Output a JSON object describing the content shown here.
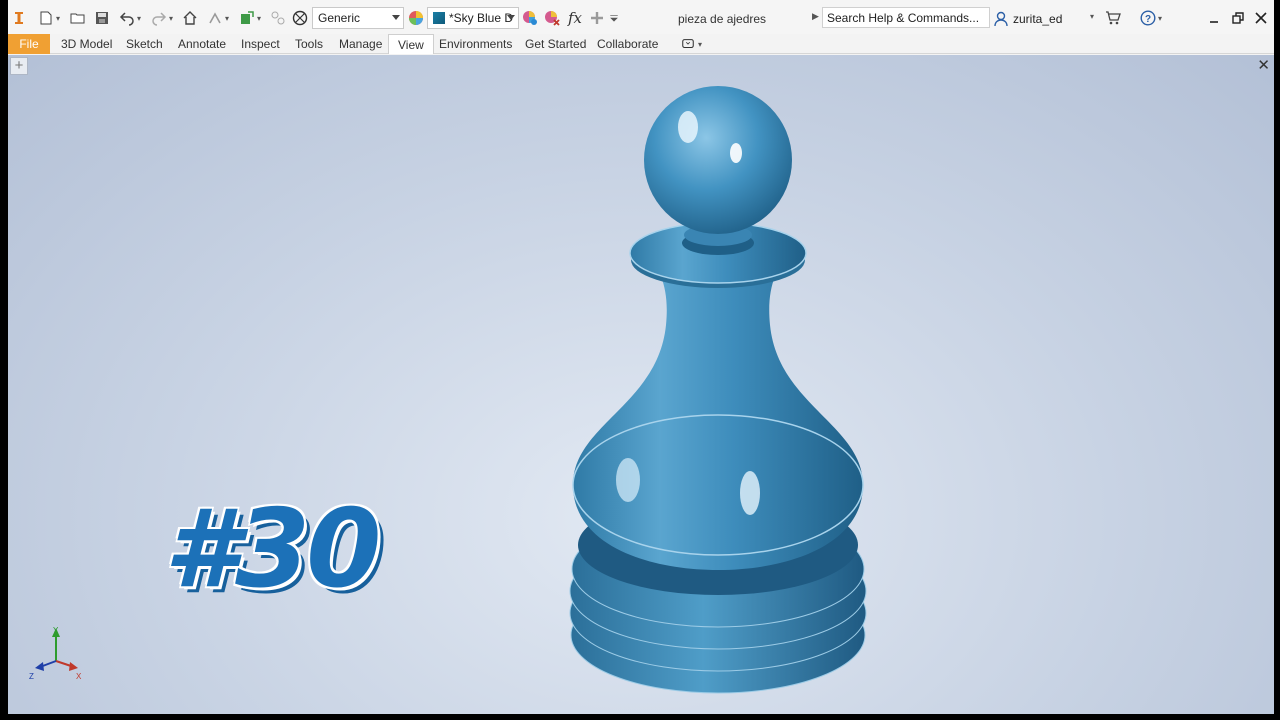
{
  "toolbar": {
    "material": "Generic",
    "appearance": "*Sky Blue D",
    "document_title": "pieza de ajedres",
    "search_placeholder": "Search Help & Commands...",
    "user": "zurita_ed"
  },
  "tabs": [
    {
      "label": "File"
    },
    {
      "label": "3D Model"
    },
    {
      "label": "Sketch"
    },
    {
      "label": "Annotate"
    },
    {
      "label": "Inspect"
    },
    {
      "label": "Tools"
    },
    {
      "label": "Manage"
    },
    {
      "label": "View"
    },
    {
      "label": "Environments"
    },
    {
      "label": "Get Started"
    },
    {
      "label": "Collaborate"
    }
  ],
  "active_tab": "View",
  "overlay_badge": "#30",
  "triad": {
    "x": "X",
    "y": "Y",
    "z": "Z"
  },
  "colors": {
    "file_tab": "#f0a033",
    "part": "#3f8fbd",
    "badge": "#1c71b8"
  },
  "icons": [
    "app-logo-icon",
    "new-icon",
    "open-icon",
    "save-icon",
    "undo-icon",
    "redo-icon",
    "home-icon",
    "return-icon",
    "update-icon",
    "measure-icon",
    "material-icon",
    "appearance-color-icon",
    "adjust-icon",
    "clear-appearance-icon",
    "fx-icon",
    "plus-icon",
    "cart-icon",
    "help-icon",
    "minimize-icon",
    "restore-icon",
    "close-icon"
  ]
}
